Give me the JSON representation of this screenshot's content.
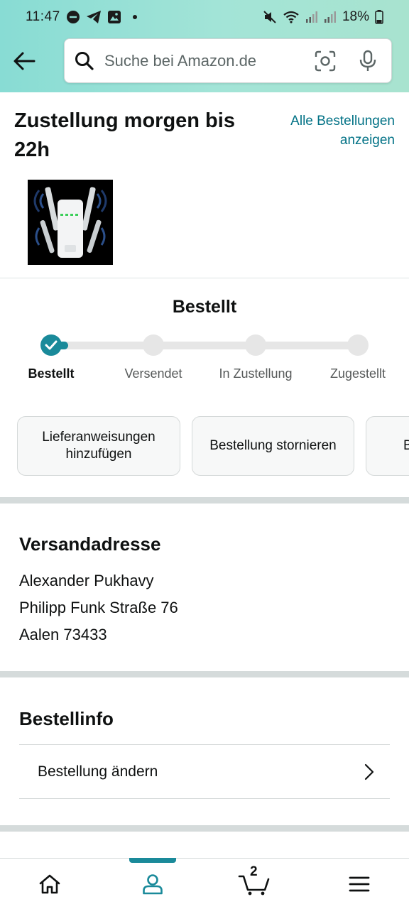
{
  "status_bar": {
    "time": "11:47",
    "battery": "18%"
  },
  "search": {
    "placeholder": "Suche bei Amazon.de"
  },
  "delivery": {
    "title": "Zustellung morgen bis 22h",
    "all_orders_link": "Alle Bestellungen anzeigen"
  },
  "progress": {
    "current_status": "Bestellt",
    "steps": [
      {
        "label": "Bestellt",
        "done": true
      },
      {
        "label": "Versendet",
        "done": false
      },
      {
        "label": "In Zustellung",
        "done": false
      },
      {
        "label": "Zugestellt",
        "done": false
      }
    ]
  },
  "actions": [
    {
      "label": "Lieferanweisungen hinzufügen"
    },
    {
      "label": "Bestellung stornieren"
    },
    {
      "label": "B"
    }
  ],
  "shipping": {
    "title": "Versandadresse",
    "name": "Alexander Pukhavy",
    "street": "Philipp Funk Straße 76",
    "city": "Aalen 73433"
  },
  "order_info": {
    "title": "Bestellinfo",
    "change_order": "Bestellung ändern"
  },
  "bottom_nav": {
    "cart_count": "2",
    "active": "account"
  },
  "colors": {
    "accent": "#1a8a9a",
    "link": "#007185",
    "header_gradient_start": "#88dcd4",
    "header_gradient_end": "#a8e3cf"
  }
}
